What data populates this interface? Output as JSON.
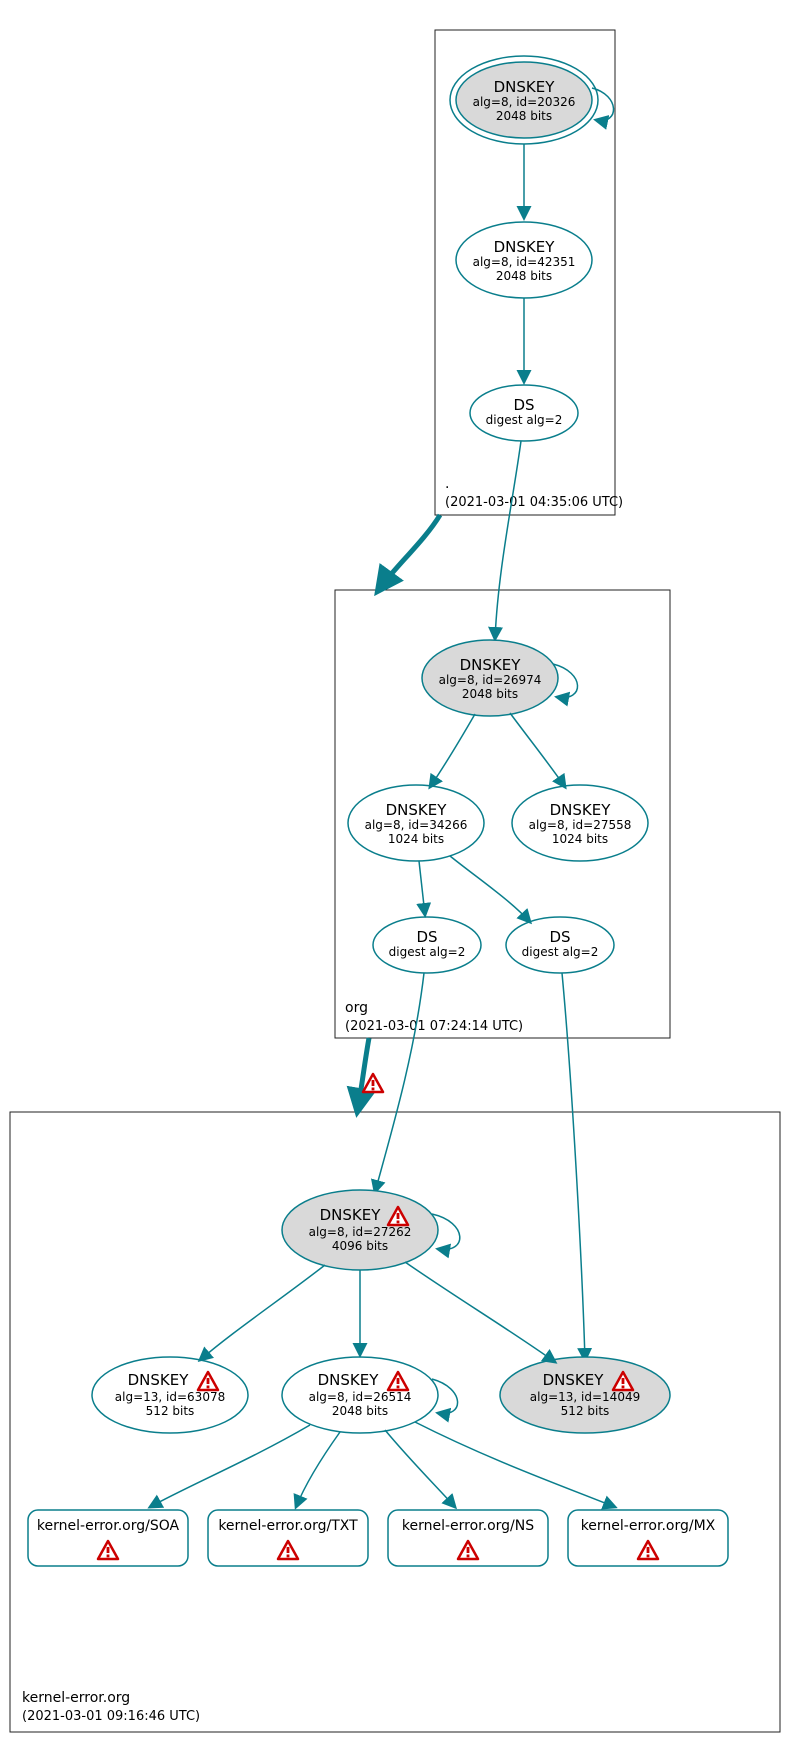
{
  "zones": {
    "root": {
      "label": ".",
      "timestamp": "(2021-03-01 04:35:06 UTC)"
    },
    "org": {
      "label": "org",
      "timestamp": "(2021-03-01 07:24:14 UTC)"
    },
    "domain": {
      "label": "kernel-error.org",
      "timestamp": "(2021-03-01 09:16:46 UTC)"
    }
  },
  "nodes": {
    "root_ksk": {
      "title": "DNSKEY",
      "l2": "alg=8, id=20326",
      "l3": "2048 bits"
    },
    "root_zsk": {
      "title": "DNSKEY",
      "l2": "alg=8, id=42351",
      "l3": "2048 bits"
    },
    "root_ds": {
      "title": "DS",
      "l2": "digest alg=2"
    },
    "org_ksk": {
      "title": "DNSKEY",
      "l2": "alg=8, id=26974",
      "l3": "2048 bits"
    },
    "org_zsk1": {
      "title": "DNSKEY",
      "l2": "alg=8, id=34266",
      "l3": "1024 bits"
    },
    "org_zsk2": {
      "title": "DNSKEY",
      "l2": "alg=8, id=27558",
      "l3": "1024 bits"
    },
    "org_ds1": {
      "title": "DS",
      "l2": "digest alg=2"
    },
    "org_ds2": {
      "title": "DS",
      "l2": "digest alg=2"
    },
    "dom_ksk": {
      "title": "DNSKEY",
      "l2": "alg=8, id=27262",
      "l3": "4096 bits"
    },
    "dom_zsk_a": {
      "title": "DNSKEY",
      "l2": "alg=13, id=63078",
      "l3": "512 bits"
    },
    "dom_zsk_b": {
      "title": "DNSKEY",
      "l2": "alg=8, id=26514",
      "l3": "2048 bits"
    },
    "dom_zsk_c": {
      "title": "DNSKEY",
      "l2": "alg=13, id=14049",
      "l3": "512 bits"
    },
    "leaf_soa": {
      "title": "kernel-error.org/SOA"
    },
    "leaf_txt": {
      "title": "kernel-error.org/TXT"
    },
    "leaf_ns": {
      "title": "kernel-error.org/NS"
    },
    "leaf_mx": {
      "title": "kernel-error.org/MX"
    }
  }
}
